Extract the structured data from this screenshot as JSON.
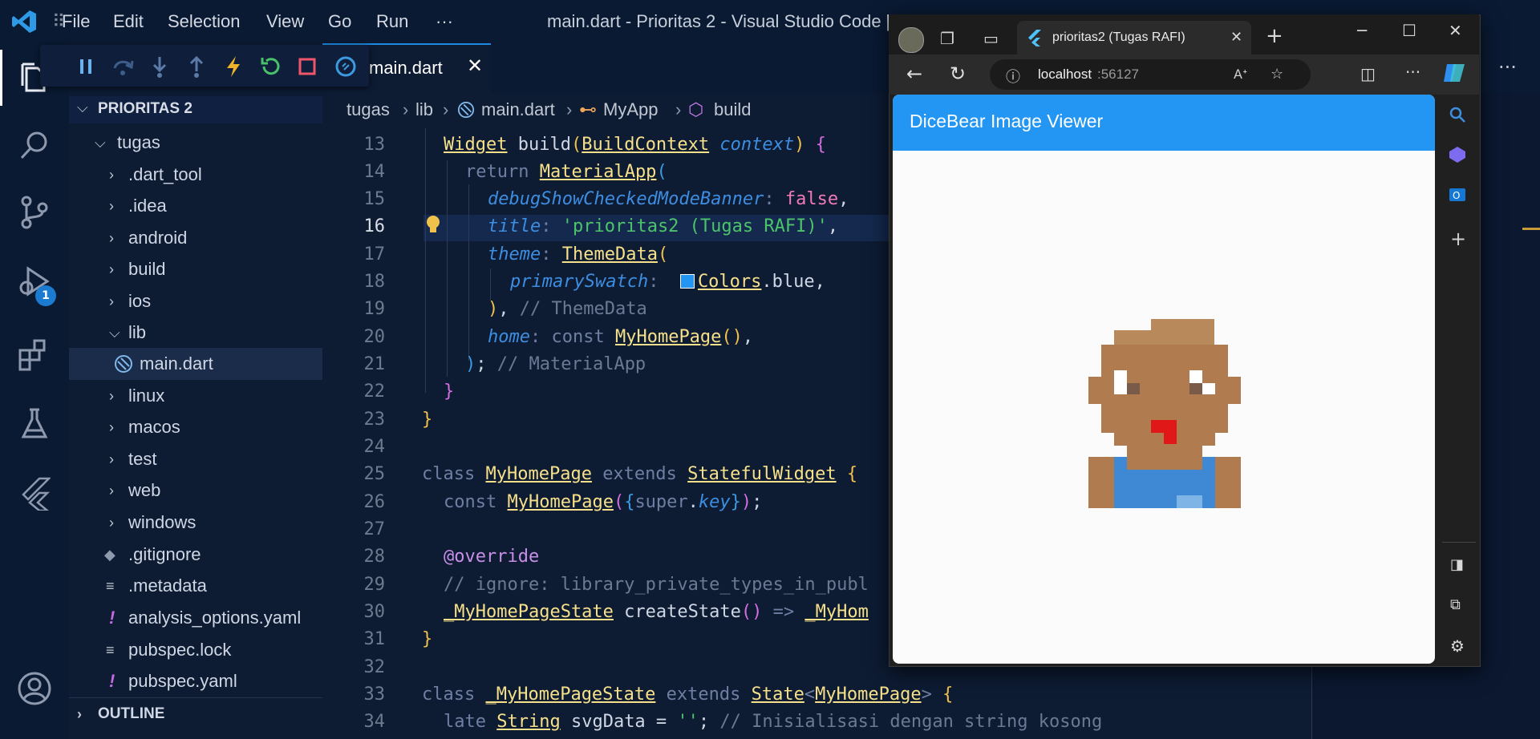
{
  "menu": [
    "File",
    "Edit",
    "Selection",
    "View",
    "Go",
    "Run",
    "···"
  ],
  "window_title": "main.dart - Prioritas 2 - Visual Studio Code [A",
  "activity": {
    "debug_badge": "1"
  },
  "explorer": {
    "root": "PRIORITAS 2",
    "items": [
      {
        "label": "tugas",
        "kind": "folder-open"
      },
      {
        "label": ".dart_tool",
        "kind": "folder"
      },
      {
        "label": ".idea",
        "kind": "folder"
      },
      {
        "label": "android",
        "kind": "folder"
      },
      {
        "label": "build",
        "kind": "folder"
      },
      {
        "label": "ios",
        "kind": "folder"
      },
      {
        "label": "lib",
        "kind": "folder-open"
      },
      {
        "label": "main.dart",
        "kind": "dart"
      },
      {
        "label": "linux",
        "kind": "folder"
      },
      {
        "label": "macos",
        "kind": "folder"
      },
      {
        "label": "test",
        "kind": "folder"
      },
      {
        "label": "web",
        "kind": "folder"
      },
      {
        "label": "windows",
        "kind": "folder"
      },
      {
        "label": ".gitignore",
        "kind": "git"
      },
      {
        "label": ".metadata",
        "kind": "file"
      },
      {
        "label": "analysis_options.yaml",
        "kind": "yaml"
      },
      {
        "label": "pubspec.lock",
        "kind": "file"
      },
      {
        "label": "pubspec.yaml",
        "kind": "yaml"
      }
    ],
    "outline": "OUTLINE"
  },
  "tab": {
    "label": "main.dart"
  },
  "breadcrumb": [
    "tugas",
    "lib",
    "main.dart",
    "MyApp",
    "build"
  ],
  "line_numbers": [
    "13",
    "14",
    "15",
    "16",
    "17",
    "18",
    "19",
    "20",
    "21",
    "22",
    "23",
    "24",
    "25",
    "26",
    "27",
    "28",
    "29",
    "30",
    "31",
    "32",
    "33",
    "34"
  ],
  "browser": {
    "tab_title": "prioritas2 (Tugas RAFI)",
    "url_host": "localhost",
    "url_port": ":56127",
    "app_title": "DiceBear Image Viewer"
  },
  "colors": {
    "accent": "#2396f3",
    "editor_bg": "#0d1b33",
    "badge": "#1a7bd0"
  }
}
